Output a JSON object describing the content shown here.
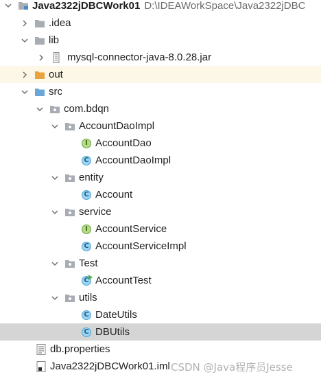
{
  "project": {
    "name": "Java2322jDBCWork01",
    "path": "D:\\IDEAWorkSpace\\Java2322jDBC"
  },
  "nodes": {
    "idea": ".idea",
    "lib": "lib",
    "jar": "mysql-connector-java-8.0.28.jar",
    "out": "out",
    "src": "src",
    "pkg": "com.bdqn",
    "daoimpl": "AccountDaoImpl",
    "dao_iface": "AccountDao",
    "dao_impl_class": "AccountDaoImpl",
    "entity": "entity",
    "account": "Account",
    "service": "service",
    "service_iface": "AccountService",
    "service_impl": "AccountServiceImpl",
    "test": "Test",
    "account_test": "AccountTest",
    "utils": "utils",
    "date_utils": "DateUtils",
    "db_utils": "DBUtils",
    "db_props": "db.properties",
    "iml": "Java2322jDBCWork01.iml"
  },
  "glyphs": {
    "class": "C",
    "interface": "I"
  },
  "watermark": "CSDN @Java程序员Jesse",
  "colors": {
    "selection": "#d5d5d5",
    "excluded_folder_bg": "#fcf7e6",
    "folder_grey": "#a8adb3",
    "source_folder_blue": "#6aa6d8",
    "out_folder_orange": "#e8a33d"
  }
}
